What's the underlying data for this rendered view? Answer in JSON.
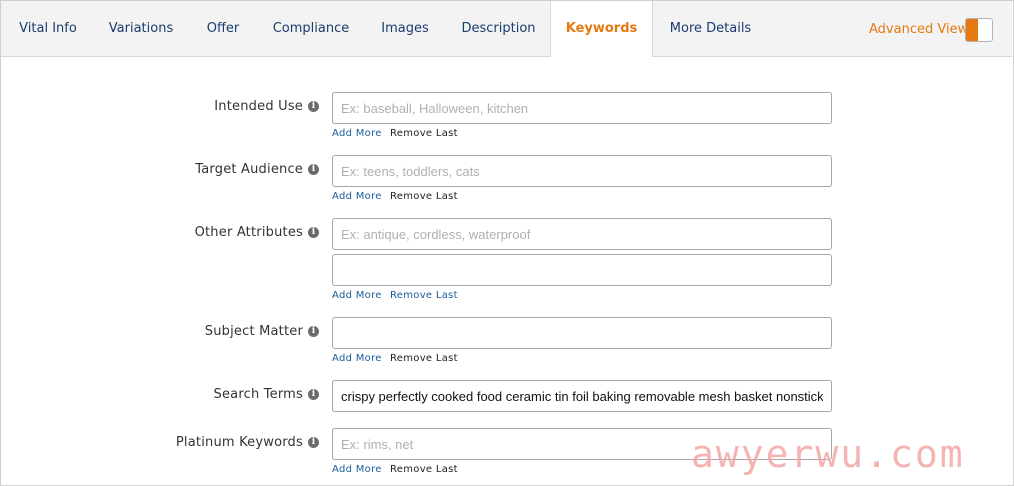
{
  "tabs": [
    {
      "label": "Vital Info"
    },
    {
      "label": "Variations"
    },
    {
      "label": "Offer"
    },
    {
      "label": "Compliance"
    },
    {
      "label": "Images"
    },
    {
      "label": "Description"
    },
    {
      "label": "Keywords"
    },
    {
      "label": "More Details"
    }
  ],
  "active_tab": "Keywords",
  "advanced_view": {
    "label": "Advanced View",
    "enabled": true
  },
  "fields": {
    "intended_use": {
      "label": "Intended Use",
      "placeholder": "Ex: baseball, Halloween, kitchen",
      "value": ""
    },
    "target_audience": {
      "label": "Target Audience",
      "placeholder": "Ex: teens, toddlers, cats",
      "value": ""
    },
    "other_attributes": {
      "label": "Other Attributes",
      "placeholder": "Ex: antique, cordless, waterproof",
      "value": "",
      "value2": ""
    },
    "subject_matter": {
      "label": "Subject Matter",
      "placeholder": "",
      "value": ""
    },
    "search_terms": {
      "label": "Search Terms",
      "placeholder": "",
      "value": "crispy perfectly cooked food ceramic tin foil baking removable mesh basket nonstick"
    },
    "platinum_keywords": {
      "label": "Platinum Keywords",
      "placeholder": "Ex: rims, net",
      "value": ""
    }
  },
  "actions": {
    "add_more": "Add More",
    "remove_last": "Remove Last"
  },
  "info_glyph": "i",
  "watermark": "awyerwu.com",
  "colors": {
    "accent": "#e47911",
    "link": "#1a5b9b",
    "tab_text": "#1a3c6e"
  }
}
